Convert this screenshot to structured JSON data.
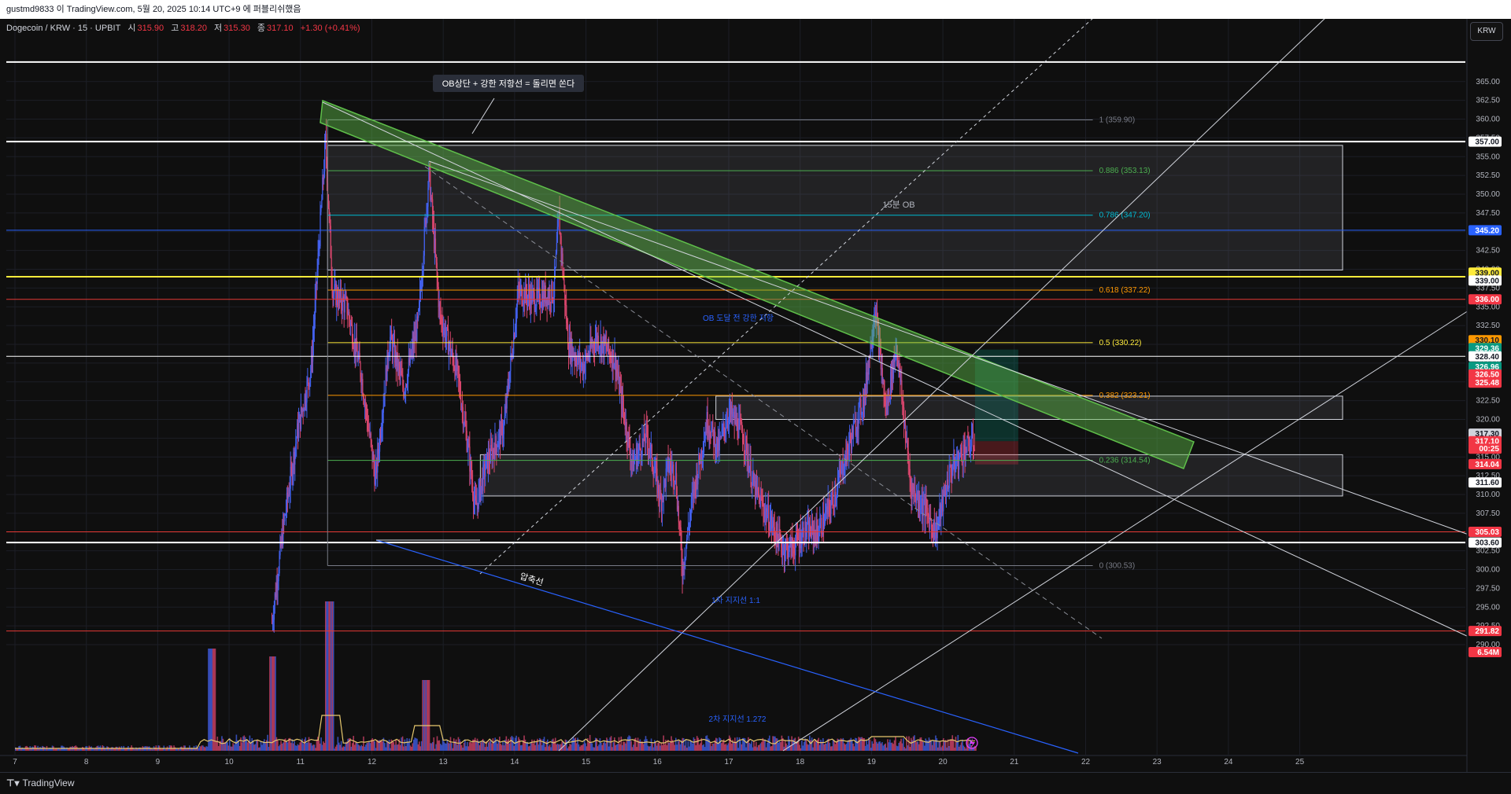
{
  "header": {
    "publish_line": "gustmd9833 이 TradingView.com, 5월 20, 2025 10:14 UTC+9 에 퍼블리쉬했음"
  },
  "symbol": {
    "name": "Dogecoin / KRW · 15 · UPBIT",
    "open_label": "시",
    "open": "315.90",
    "high_label": "고",
    "high": "318.20",
    "low_label": "저",
    "low": "315.30",
    "close_label": "종",
    "close": "317.10",
    "change": "+1.30 (+0.41%)",
    "currency": "KRW"
  },
  "footer": {
    "brand": "TradingView"
  },
  "colors": {
    "background": "#0f0f0f",
    "up": "#4361ee",
    "down": "#d9466d",
    "green_channel": "#5fbf4a",
    "fib_gray": "#787b86"
  },
  "chart_data": {
    "type": "candlestick",
    "x_ticks": [
      "7",
      "8",
      "9",
      "10",
      "11",
      "12",
      "13",
      "14",
      "15",
      "16",
      "17",
      "18",
      "19",
      "20",
      "21",
      "22",
      "23",
      "24",
      "25"
    ],
    "y_ticks": [
      "365.00",
      "362.50",
      "360.00",
      "357.50",
      "355.00",
      "352.50",
      "350.00",
      "347.50",
      "345.00",
      "342.50",
      "340.00",
      "337.50",
      "335.00",
      "332.50",
      "330.00",
      "327.50",
      "325.00",
      "322.50",
      "320.00",
      "317.50",
      "315.00",
      "312.50",
      "310.00",
      "307.50",
      "305.00",
      "302.50",
      "300.00",
      "297.50",
      "295.00",
      "292.50",
      "290.00"
    ],
    "ylim": [
      288.5,
      368
    ],
    "price_path": [
      [
        10.6,
        293
      ],
      [
        10.75,
        305
      ],
      [
        10.95,
        318
      ],
      [
        11.15,
        327
      ],
      [
        11.35,
        357
      ],
      [
        11.45,
        337
      ],
      [
        11.65,
        335
      ],
      [
        11.85,
        326
      ],
      [
        12.05,
        312
      ],
      [
        12.25,
        331
      ],
      [
        12.45,
        324
      ],
      [
        12.65,
        333
      ],
      [
        12.8,
        353
      ],
      [
        12.95,
        334
      ],
      [
        13.2,
        326
      ],
      [
        13.35,
        316
      ],
      [
        13.45,
        308
      ],
      [
        13.6,
        314
      ],
      [
        13.85,
        319
      ],
      [
        14.05,
        337
      ],
      [
        14.3,
        336
      ],
      [
        14.55,
        337
      ],
      [
        14.62,
        347
      ],
      [
        14.75,
        330
      ],
      [
        14.95,
        327
      ],
      [
        15.15,
        331
      ],
      [
        15.4,
        328
      ],
      [
        15.65,
        314
      ],
      [
        15.85,
        318
      ],
      [
        16.05,
        309
      ],
      [
        16.15,
        314
      ],
      [
        16.25,
        313
      ],
      [
        16.35,
        300
      ],
      [
        16.5,
        310
      ],
      [
        16.7,
        320
      ],
      [
        16.85,
        316
      ],
      [
        17.0,
        321
      ],
      [
        17.2,
        318
      ],
      [
        17.35,
        311
      ],
      [
        17.55,
        307
      ],
      [
        17.75,
        303
      ],
      [
        17.9,
        303
      ],
      [
        18.05,
        305
      ],
      [
        18.25,
        305
      ],
      [
        18.45,
        309
      ],
      [
        18.7,
        317
      ],
      [
        18.9,
        323
      ],
      [
        19.05,
        335
      ],
      [
        19.2,
        321
      ],
      [
        19.35,
        330
      ],
      [
        19.55,
        311
      ],
      [
        19.75,
        308
      ],
      [
        19.9,
        305
      ],
      [
        20.1,
        313
      ],
      [
        20.3,
        316
      ],
      [
        20.45,
        317.1
      ]
    ],
    "horizontal_levels": [
      {
        "price": 367.6,
        "color": "#ffffff",
        "width": 2
      },
      {
        "price": 357.0,
        "color": "#ffffff",
        "width": 2
      },
      {
        "price": 345.2,
        "color": "#2962ff",
        "width": 1
      },
      {
        "price": 339.0,
        "color": "#ffeb3b",
        "width": 2
      },
      {
        "price": 336.0,
        "color": "#e53935",
        "width": 1
      },
      {
        "price": 328.4,
        "color": "#ffffff",
        "width": 1
      },
      {
        "price": 305.03,
        "color": "#e53935",
        "width": 1
      },
      {
        "price": 303.6,
        "color": "#ffffff",
        "width": 2
      },
      {
        "price": 291.82,
        "color": "#e53935",
        "width": 1
      }
    ],
    "fib_levels": [
      {
        "ratio": "1",
        "price": 359.9,
        "label": "1 (359.90)",
        "color": "#787b86"
      },
      {
        "ratio": "0.886",
        "price": 353.13,
        "label": "0.886 (353.13)",
        "color": "#4caf50"
      },
      {
        "ratio": "0.786",
        "price": 347.2,
        "label": "0.786 (347.20)",
        "color": "#00bcd4"
      },
      {
        "ratio": "0.618",
        "price": 337.22,
        "label": "0.618 (337.22)",
        "color": "#ff9800"
      },
      {
        "ratio": "0.5",
        "price": 330.22,
        "label": "0.5 (330.22)",
        "color": "#ffeb3b"
      },
      {
        "ratio": "0.382",
        "price": 323.21,
        "label": "0.382 (323.21)",
        "color": "#ff9800"
      },
      {
        "ratio": "0.236",
        "price": 314.54,
        "label": "0.236 (314.54)",
        "color": "#4caf50"
      },
      {
        "ratio": "0",
        "price": 300.53,
        "label": "0 (300.53)",
        "color": "#787b86"
      }
    ],
    "zones": [
      {
        "x0": 11.38,
        "x1": 25.6,
        "p0": 356.5,
        "p1": 339.9
      },
      {
        "x0": 13.52,
        "x1": 25.6,
        "p0": 315.3,
        "p1": 309.8
      },
      {
        "x0": 16.82,
        "x1": 25.6,
        "p0": 323.1,
        "p1": 320.0
      }
    ],
    "price_labels": [
      {
        "text": "357.00",
        "price": 357.0,
        "bg": "#ffffff",
        "fg": "#131722"
      },
      {
        "text": "345.20",
        "price": 345.2,
        "bg": "#2962ff",
        "fg": "#ffffff"
      },
      {
        "text": "339.00",
        "price": 339.55,
        "bg": "#ffeb3b",
        "fg": "#131722"
      },
      {
        "text": "339.00",
        "price": 338.5,
        "bg": "#ffffff",
        "fg": "#131722"
      },
      {
        "text": "336.00",
        "price": 336.0,
        "bg": "#f23645",
        "fg": "#ffffff"
      },
      {
        "text": "330.10",
        "price": 330.55,
        "bg": "#ff9800",
        "fg": "#131722"
      },
      {
        "text": "329.36",
        "price": 329.5,
        "bg": "#089981",
        "fg": "#ffffff"
      },
      {
        "text": "328.40",
        "price": 328.4,
        "bg": "#ffffff",
        "fg": "#131722"
      },
      {
        "text": "326.96",
        "price": 327.0,
        "bg": "#089981",
        "fg": "#ffffff"
      },
      {
        "text": "326.50",
        "price": 326.0,
        "bg": "#f23645",
        "fg": "#ffffff"
      },
      {
        "text": "325.48",
        "price": 324.9,
        "bg": "#f23645",
        "fg": "#ffffff"
      },
      {
        "text": "317.30",
        "price": 318.1,
        "bg": "#d1d4dc",
        "fg": "#131722"
      },
      {
        "text": "317.10",
        "price": 317.1,
        "bg": "#f23645",
        "fg": "#ffffff"
      },
      {
        "text": "00:25",
        "price": 316.1,
        "bg": "#f23645",
        "fg": "#ffffff"
      },
      {
        "text": "314.04",
        "price": 314.04,
        "bg": "#f23645",
        "fg": "#ffffff"
      },
      {
        "text": "311.60",
        "price": 311.6,
        "bg": "#ffffff",
        "fg": "#131722"
      },
      {
        "text": "305.03",
        "price": 305.03,
        "bg": "#f23645",
        "fg": "#ffffff"
      },
      {
        "text": "303.60",
        "price": 303.6,
        "bg": "#ffffff",
        "fg": "#131722"
      },
      {
        "text": "291.82",
        "price": 291.82,
        "bg": "#f23645",
        "fg": "#ffffff"
      },
      {
        "text": "6.54M",
        "price": 289.0,
        "bg": "#f23645",
        "fg": "#ffffff"
      }
    ],
    "annotations": [
      {
        "text": "OB상단 + 강한 저항선 = 돌리면 쏜다",
        "type": "callout"
      },
      {
        "text": "15분 OB",
        "type": "text"
      },
      {
        "text": "OB 도달 전 강한 저항",
        "type": "text"
      },
      {
        "text": "압축선",
        "type": "text"
      },
      {
        "text": "1차 지지선 1:1",
        "type": "text"
      },
      {
        "text": "2차 지지선 1.272",
        "type": "text"
      }
    ]
  }
}
